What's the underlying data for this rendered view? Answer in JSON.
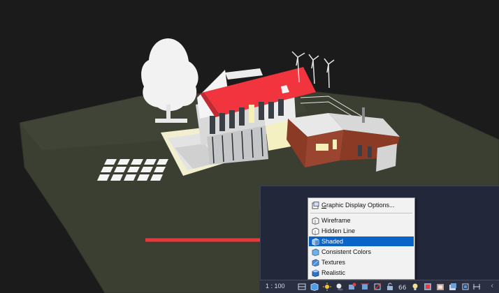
{
  "view_menu": {
    "header": "Graphic Display Options...",
    "items": [
      {
        "label": "Wireframe",
        "icon": "wireframe-icon",
        "selected": false
      },
      {
        "label": "Hidden Line",
        "icon": "hidden-line-icon",
        "selected": false
      },
      {
        "label": "Shaded",
        "icon": "shaded-icon",
        "selected": true
      },
      {
        "label": "Consistent Colors",
        "icon": "consistent-colors-icon",
        "selected": false
      },
      {
        "label": "Textures",
        "icon": "textures-icon",
        "selected": false
      },
      {
        "label": "Realistic",
        "icon": "realistic-icon",
        "selected": false
      }
    ]
  },
  "status_bar": {
    "scale": "1 : 100",
    "icons": [
      "detail-level-icon",
      "visual-style-icon",
      "sun-path-icon",
      "shadows-icon",
      "render-icon",
      "crop-view-icon",
      "show-crop-icon",
      "unlock-3d-icon",
      "temporary-hide-icon",
      "reveal-hidden-icon",
      "worksharing-icon",
      "temporary-view-icon",
      "analytical-model-icon",
      "highlight-displacement-icon",
      "constraints-icon"
    ]
  },
  "colors": {
    "roof": "#f2343e",
    "cladding": "#8a3a25",
    "ground": "#3b3f32",
    "menu_selected": "#0a64c8",
    "arrow": "#e8383c",
    "overlay_bg": "#22283a"
  }
}
